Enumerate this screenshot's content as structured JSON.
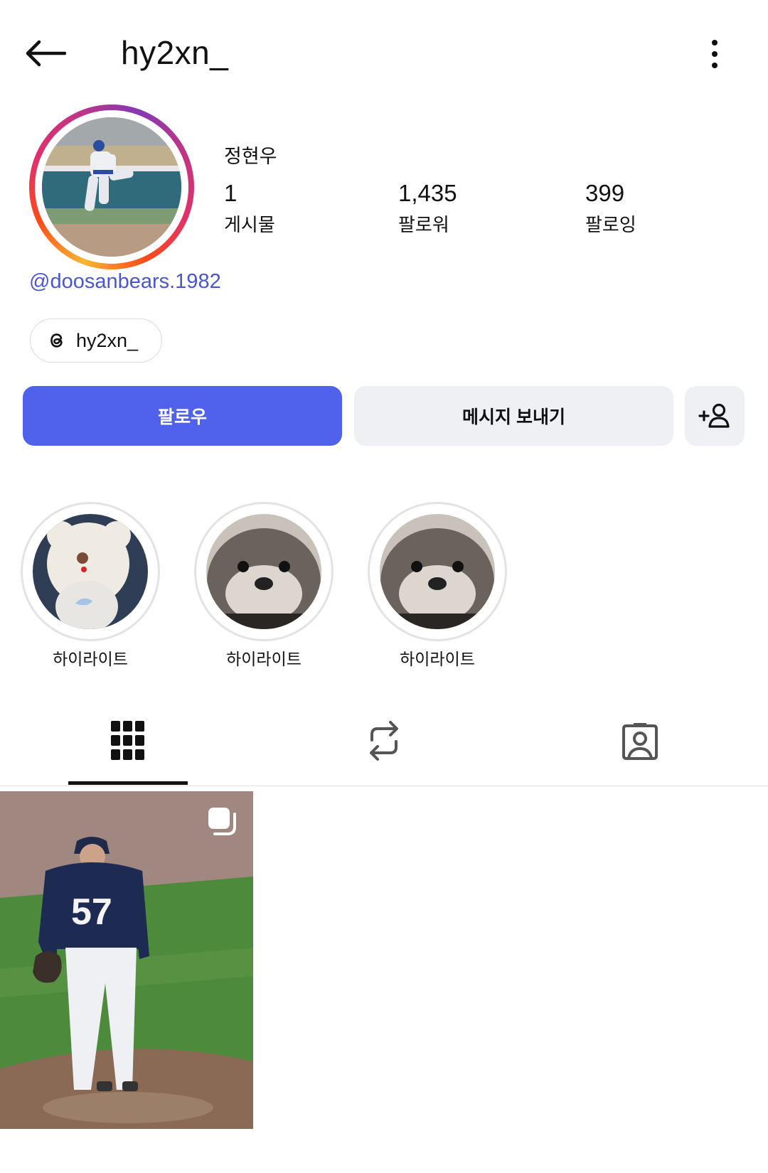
{
  "header": {
    "back_icon": "arrow-left-icon",
    "username": "hy2xn_",
    "more_icon": "more-vertical-icon"
  },
  "profile": {
    "display_name": "정현우",
    "stats": [
      {
        "value": "1",
        "label": "게시물"
      },
      {
        "value": "1,435",
        "label": "팔로워"
      },
      {
        "value": "399",
        "label": "팔로잉"
      }
    ],
    "bio_link": "@doosanbears.1982",
    "threads_chip": {
      "icon": "threads-icon",
      "label": "hy2xn_"
    }
  },
  "actions": {
    "follow": "팔로우",
    "message": "메시지 보내기",
    "add_user_icon": "add-user-icon"
  },
  "highlights": [
    {
      "label": "하이라이트"
    },
    {
      "label": "하이라이트"
    },
    {
      "label": "하이라이트"
    }
  ],
  "tabs": [
    {
      "icon": "grid-icon",
      "active": true
    },
    {
      "icon": "repost-icon",
      "active": false
    },
    {
      "icon": "tagged-icon",
      "active": false
    }
  ],
  "posts": [
    {
      "type": "carousel",
      "jersey_number": "57"
    }
  ],
  "colors": {
    "accent": "#5062ec",
    "link": "#4a56cf",
    "secondary_button": "#eff0f3"
  }
}
